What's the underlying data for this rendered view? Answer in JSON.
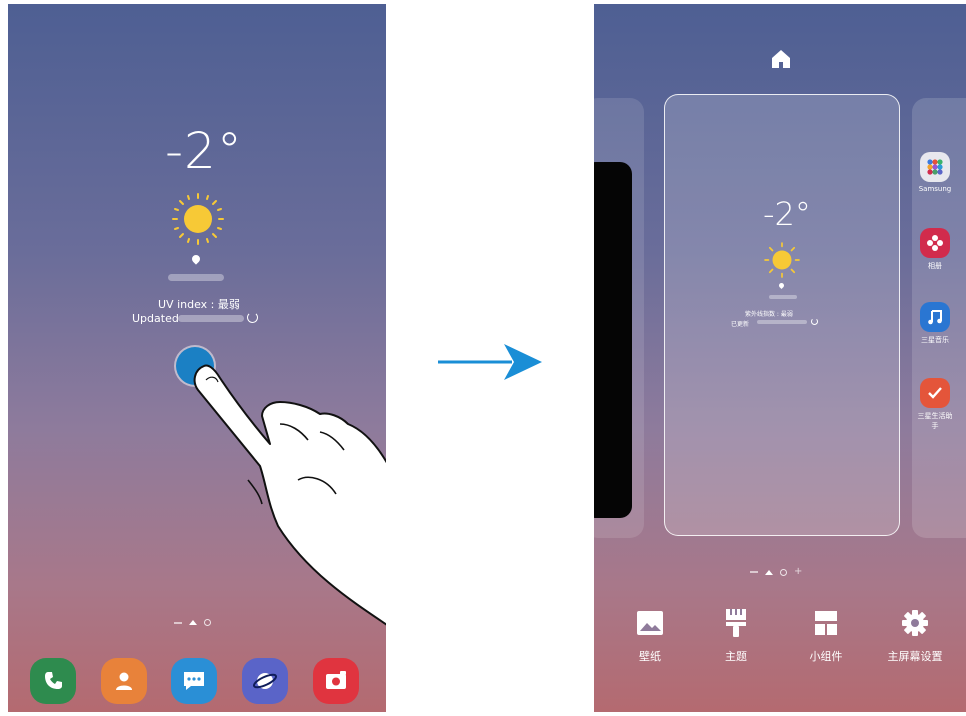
{
  "left_screen": {
    "weather": {
      "temperature": "-2°",
      "uv_label": "UV index : 最弱",
      "updated_label": "Updated"
    }
  },
  "right_screen": {
    "preview_weather": {
      "temperature": "-2°",
      "uv_label": "紫外线指数 : 最弱",
      "updated_label": "已更新"
    },
    "side_apps": [
      {
        "label": "Samsung",
        "icon": "samsung-folder-icon",
        "color": "#e8e8ee"
      },
      {
        "label": "相册",
        "icon": "gallery-icon",
        "color": "#d12b4c"
      },
      {
        "label": "三星音乐",
        "icon": "music-icon",
        "color": "#2a76d2"
      },
      {
        "label": "三星生活助手",
        "icon": "reminder-icon",
        "color": "#e4553a"
      }
    ],
    "edit_options": [
      {
        "label": "壁纸",
        "icon": "wallpaper-icon"
      },
      {
        "label": "主题",
        "icon": "themes-icon"
      },
      {
        "label": "小组件",
        "icon": "widgets-icon"
      },
      {
        "label": "主屏幕设置",
        "icon": "settings-gear-icon"
      }
    ]
  },
  "dock_apps": [
    {
      "icon": "phone-icon",
      "color": "#2e8b4e"
    },
    {
      "icon": "contacts-icon",
      "color": "#e8823a"
    },
    {
      "icon": "messages-icon",
      "color": "#2a8fd6"
    },
    {
      "icon": "internet-icon",
      "color": "#5a64c8"
    },
    {
      "icon": "camera-icon",
      "color": "#e0343f"
    }
  ],
  "colors": {
    "tap_indicator": "#1b80c4",
    "arrow": "#1a8ed6"
  }
}
